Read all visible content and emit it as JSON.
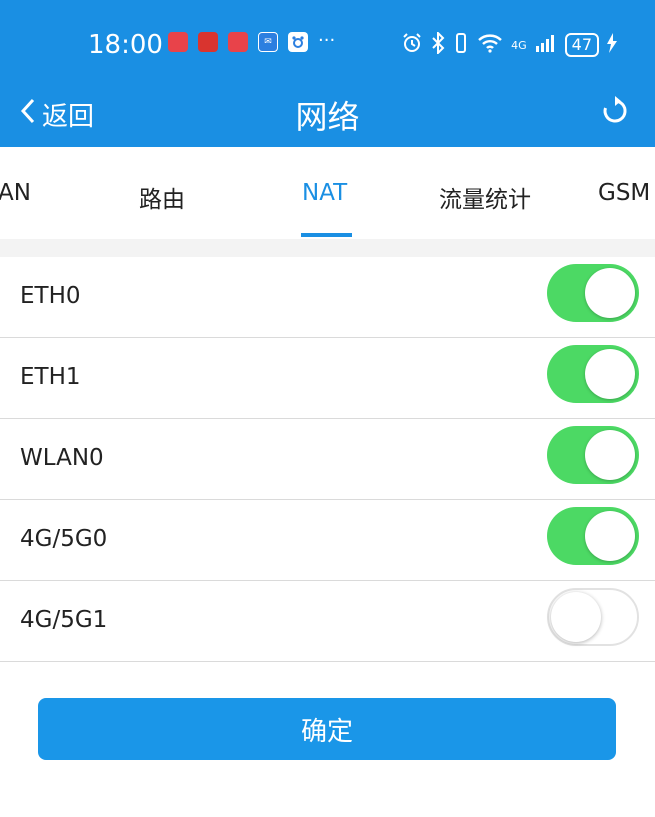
{
  "status_bar": {
    "time": "18:00",
    "battery": "47",
    "network": "4G",
    "overflow_dots": "···",
    "notification_icons": [
      "huawei-store-icon",
      "game-icon",
      "reader-icon",
      "mail-icon",
      "baidu-icon"
    ]
  },
  "nav": {
    "back_label": "返回",
    "title": "网络"
  },
  "tabs": [
    {
      "label": "AN"
    },
    {
      "label": "路由"
    },
    {
      "label": "NAT"
    },
    {
      "label": "流量统计"
    },
    {
      "label": "GSM"
    }
  ],
  "active_tab": "NAT",
  "rows": [
    {
      "label": "ETH0",
      "enabled": true
    },
    {
      "label": "ETH1",
      "enabled": true
    },
    {
      "label": "WLAN0",
      "enabled": true
    },
    {
      "label": "4G/5G0",
      "enabled": true
    },
    {
      "label": "4G/5G1",
      "enabled": false
    }
  ],
  "confirm_label": "确定",
  "colors": {
    "primary": "#1a8fe3",
    "toggle_on": "#4cd964",
    "toggle_off": "#ffffff"
  }
}
